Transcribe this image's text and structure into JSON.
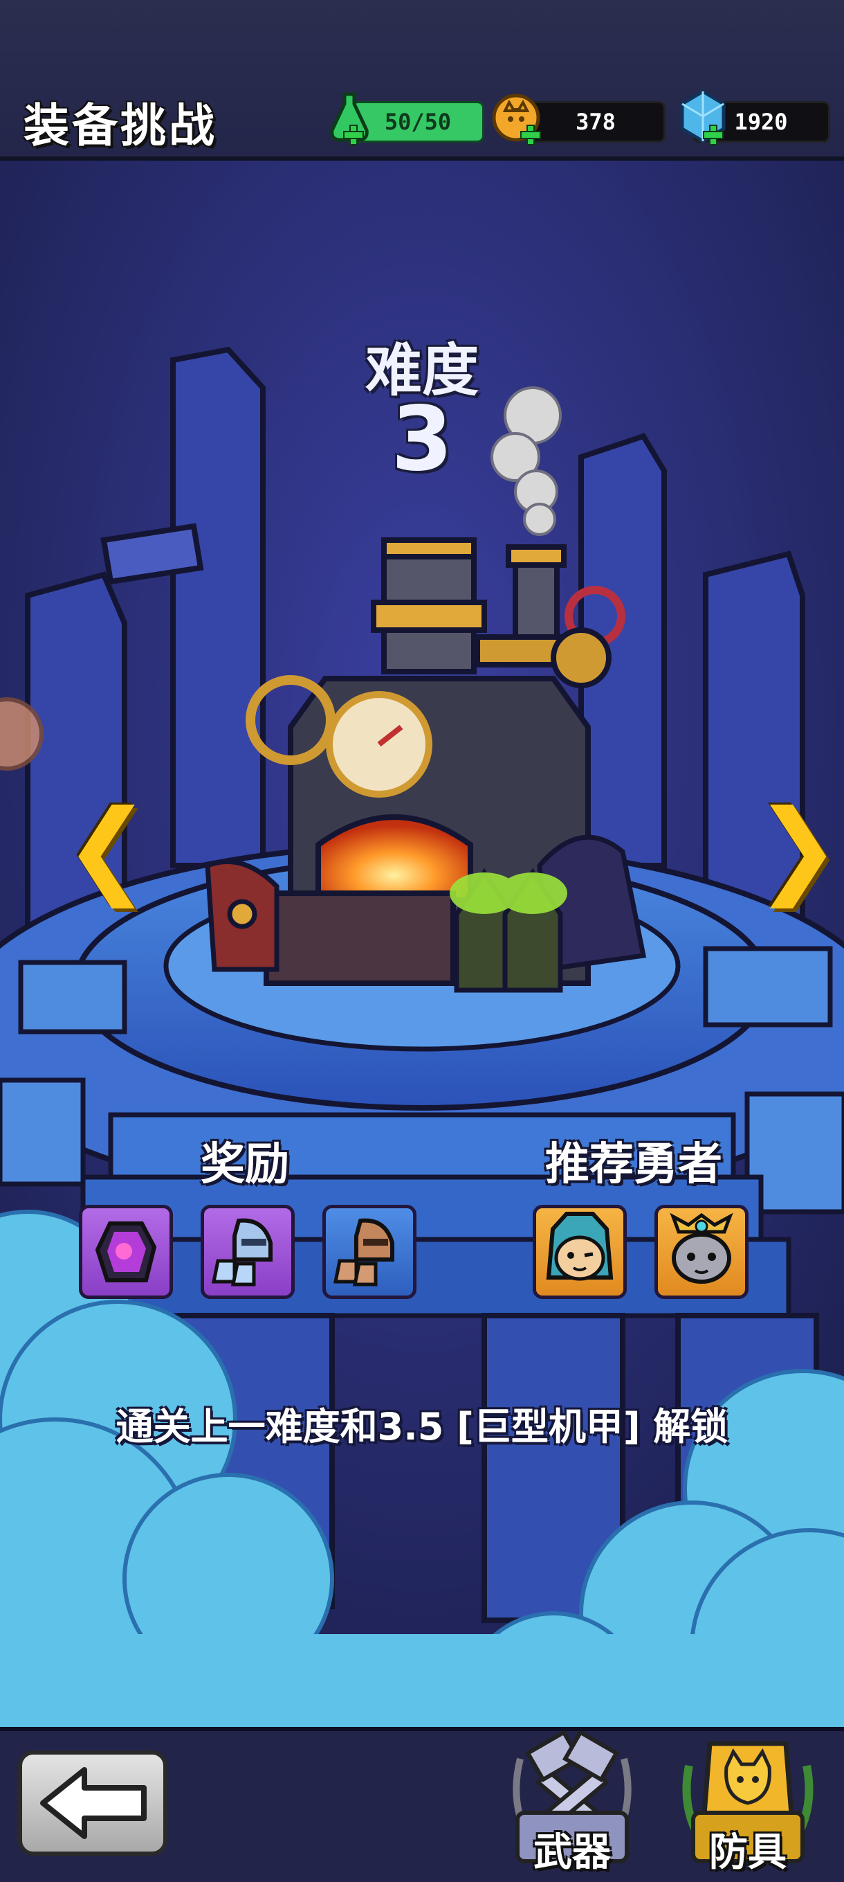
{
  "header": {
    "title": "装备挑战",
    "energy": "50/50",
    "coins": "378",
    "gems": "1920"
  },
  "difficulty": {
    "label": "难度",
    "level": "3"
  },
  "rewards": {
    "label": "奖励",
    "items": [
      "dark-gem-icon",
      "silver-helmet-boots-icon",
      "bronze-helmet-boots-icon"
    ]
  },
  "heroes": {
    "label": "推荐勇者",
    "items": [
      "hooded-cat-hero-icon",
      "crowned-cat-hero-icon"
    ]
  },
  "unlock_text": "通关上一难度和3.5 [巨型机甲] 解锁",
  "bottom": {
    "weapons_label": "武器",
    "armor_label": "防具"
  },
  "colors": {
    "accent_yellow": "#ffc61a",
    "energy_green": "#36c865",
    "background_navy": "#1f2146"
  }
}
